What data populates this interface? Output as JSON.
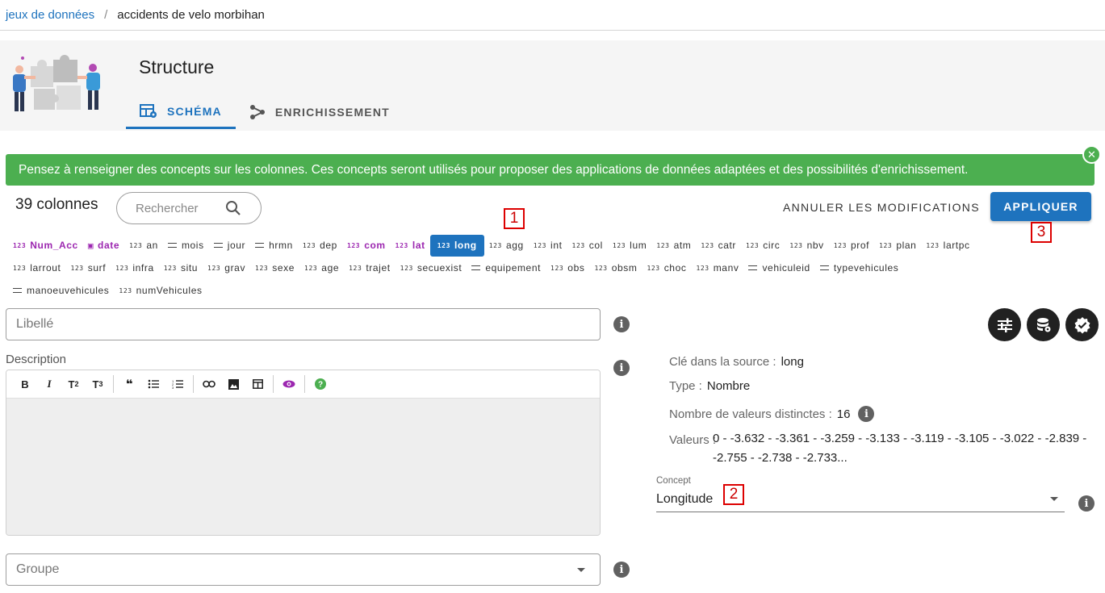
{
  "breadcrumb": {
    "link": "jeux de données",
    "separator": "/",
    "current": "accidents de velo morbihan"
  },
  "header": {
    "title": "Structure",
    "tabs": [
      {
        "label": "SCHÉMA",
        "icon": "table-cog-icon",
        "active": true
      },
      {
        "label": "ENRICHISSEMENT",
        "icon": "graph-icon",
        "active": false
      }
    ]
  },
  "alert": {
    "text": "Pensez à renseigner des concepts sur les colonnes. Ces concepts seront utilisés pour proposer des applications de données adaptées et des possibilités d'enrichissement.",
    "color": "#4caf50"
  },
  "toolbar": {
    "column_count": "39 colonnes",
    "search_placeholder": "Rechercher",
    "cancel_label": "ANNULER LES MODIFICATIONS",
    "apply_label": "APPLIQUER"
  },
  "columns": [
    [
      {
        "name": "Num_Acc",
        "type": "number",
        "concept": true
      },
      {
        "name": "date",
        "type": "date",
        "concept": true
      },
      {
        "name": "an",
        "type": "number"
      },
      {
        "name": "mois",
        "type": "string"
      },
      {
        "name": "jour",
        "type": "string"
      },
      {
        "name": "hrmn",
        "type": "string"
      },
      {
        "name": "dep",
        "type": "number"
      },
      {
        "name": "com",
        "type": "number",
        "concept": true
      },
      {
        "name": "lat",
        "type": "number",
        "concept": true
      },
      {
        "name": "long",
        "type": "number",
        "concept": true,
        "active": true
      },
      {
        "name": "agg",
        "type": "number"
      },
      {
        "name": "int",
        "type": "number"
      },
      {
        "name": "col",
        "type": "number"
      },
      {
        "name": "lum",
        "type": "number"
      },
      {
        "name": "atm",
        "type": "number"
      },
      {
        "name": "catr",
        "type": "number"
      },
      {
        "name": "circ",
        "type": "number"
      },
      {
        "name": "nbv",
        "type": "number"
      },
      {
        "name": "prof",
        "type": "number"
      },
      {
        "name": "plan",
        "type": "number"
      },
      {
        "name": "lartpc",
        "type": "number"
      }
    ],
    [
      {
        "name": "larrout",
        "type": "number"
      },
      {
        "name": "surf",
        "type": "number"
      },
      {
        "name": "infra",
        "type": "number"
      },
      {
        "name": "situ",
        "type": "number"
      },
      {
        "name": "grav",
        "type": "number"
      },
      {
        "name": "sexe",
        "type": "number"
      },
      {
        "name": "age",
        "type": "number"
      },
      {
        "name": "trajet",
        "type": "number"
      },
      {
        "name": "secuexist",
        "type": "number"
      },
      {
        "name": "equipement",
        "type": "string"
      },
      {
        "name": "obs",
        "type": "number"
      },
      {
        "name": "obsm",
        "type": "number"
      },
      {
        "name": "choc",
        "type": "number"
      },
      {
        "name": "manv",
        "type": "number"
      },
      {
        "name": "vehiculeid",
        "type": "string"
      },
      {
        "name": "typevehicules",
        "type": "string"
      }
    ],
    [
      {
        "name": "manoeuvehicules",
        "type": "string"
      },
      {
        "name": "numVehicules",
        "type": "number"
      }
    ]
  ],
  "type_icons": {
    "number": "123",
    "concept_color": "#9c27b0",
    "accent": "#1e73be"
  },
  "form": {
    "libelle_placeholder": "Libellé",
    "description_label": "Description",
    "groupe_placeholder": "Groupe",
    "info_glyph": "i"
  },
  "details": {
    "source_key_label": "Clé dans la source :",
    "source_key_value": "long",
    "type_label": "Type :",
    "type_value": "Nombre",
    "distinct_label": "Nombre de valeurs distinctes :",
    "distinct_value": "16",
    "values_label": "Valeurs :",
    "values_text": "0 - -3.632 - -3.361 - -3.259 - -3.133 - -3.119 - -3.105 - -3.022 - -2.839 - -2.755 - -2.738 - -2.733...",
    "concept_label": "Concept",
    "concept_value": "Longitude"
  },
  "markers": [
    "1",
    "2",
    "3"
  ]
}
